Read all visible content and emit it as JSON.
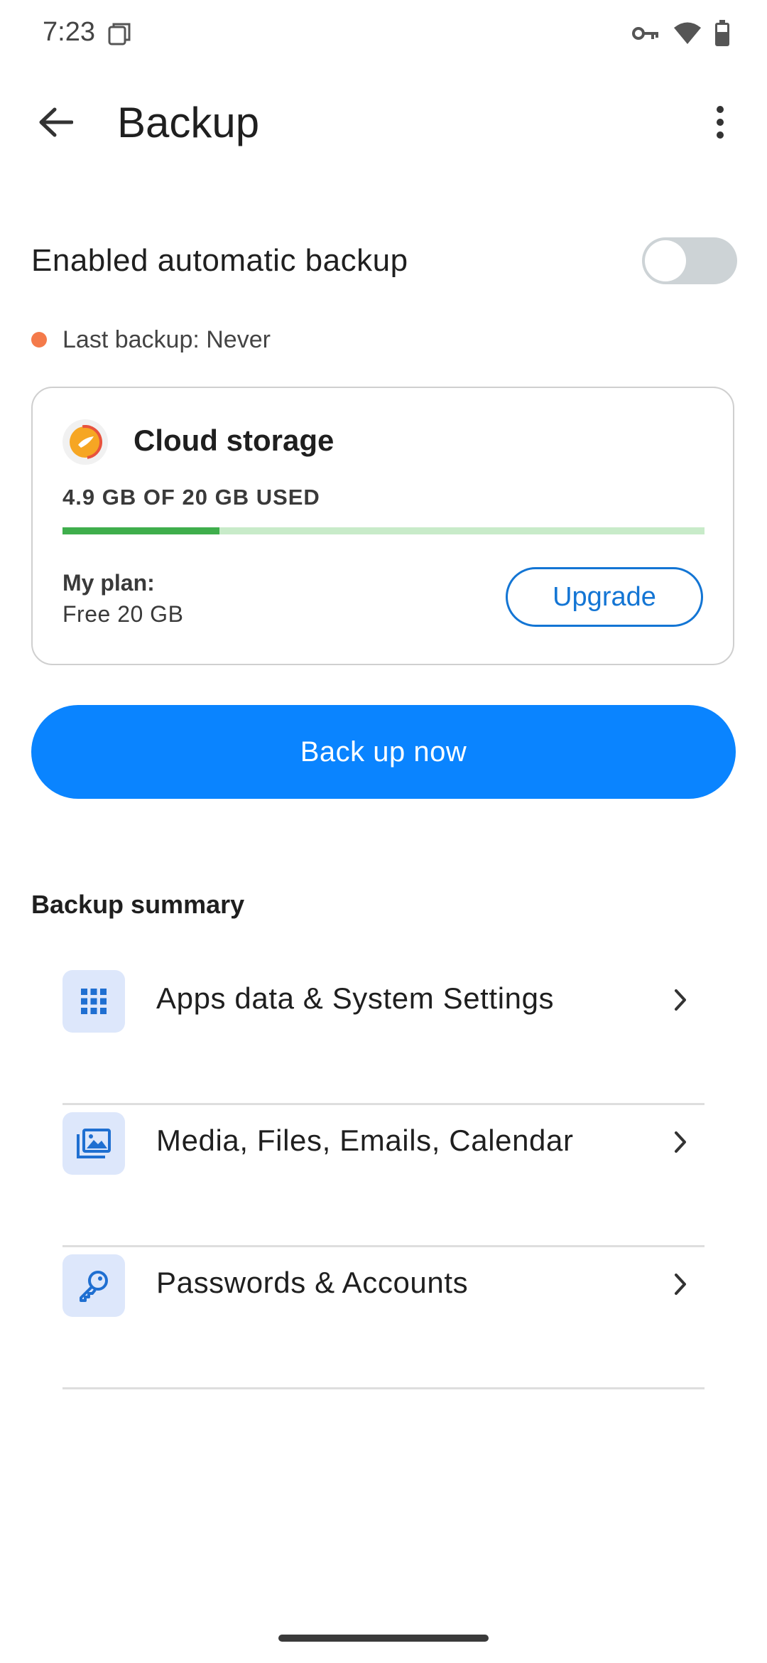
{
  "status_bar": {
    "time": "7:23",
    "icons": [
      "screenshot-notification-icon",
      "vpn-key-icon",
      "wifi-icon",
      "battery-icon"
    ]
  },
  "app_bar": {
    "title": "Backup",
    "back_icon": "arrow-back-icon",
    "more_icon": "more-vertical-icon"
  },
  "auto_backup": {
    "label": "Enabled automatic backup",
    "toggle_on": false,
    "last_backup": "Last backup: Never",
    "status_color": "#f47a4a"
  },
  "storage_card": {
    "title": "Cloud storage",
    "usage": "4.9 GB OF 20 GB USED",
    "used_fraction": 0.245,
    "plan_label": "My plan:",
    "plan_value": "Free 20 GB",
    "upgrade_label": "Upgrade"
  },
  "backup_now_label": "Back up now",
  "summary": {
    "heading": "Backup summary",
    "items": [
      {
        "label": "Apps data & System Settings",
        "icon": "apps-grid-icon"
      },
      {
        "label": "Media, Files, Emails, Calendar",
        "icon": "media-gallery-icon"
      },
      {
        "label": "Passwords & Accounts",
        "icon": "key-icon"
      }
    ]
  },
  "colors": {
    "accent": "#0a84ff",
    "link": "#1375d4",
    "progress": "#3fae4c",
    "progress_track": "#c8ebc9"
  }
}
